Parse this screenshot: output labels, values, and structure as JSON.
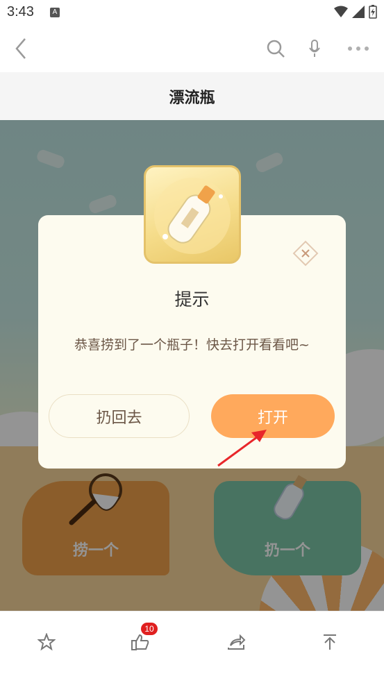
{
  "status_bar": {
    "time": "3:43",
    "notification_letter": "A"
  },
  "app_bar": {
    "back_icon": "chevron-left-icon",
    "search_icon": "search-icon",
    "mic_icon": "microphone-icon",
    "more_icon": "more-horizontal-icon"
  },
  "page": {
    "title": "漂流瓶"
  },
  "game": {
    "pick_label": "捞一个",
    "throw_label": "扔一个"
  },
  "dialog": {
    "title": "提示",
    "message": "恭喜捞到了一个瓶子！快去打开看看吧~",
    "throw_back_label": "扔回去",
    "open_label": "打开"
  },
  "bottom_nav": {
    "like_count": "10"
  },
  "colors": {
    "accent": "#ffa95c",
    "dialog_bg": "#fdfbef",
    "badge": "#e02020",
    "arrow": "#e8262a"
  }
}
